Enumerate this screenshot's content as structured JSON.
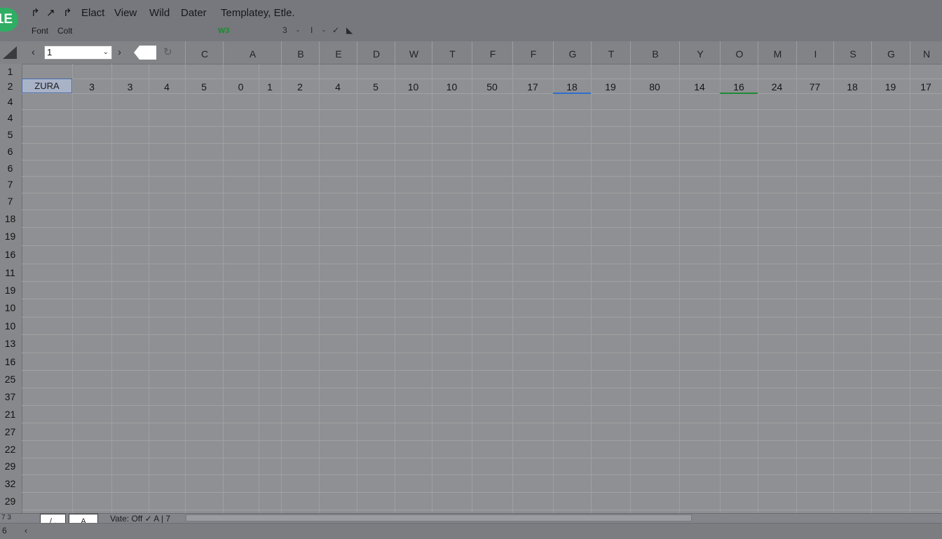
{
  "app": {
    "logo_text": "1E"
  },
  "quick_access": [
    "↱",
    "↗",
    "↱"
  ],
  "menu": [
    "Elact",
    "View",
    "Wild",
    "Dater",
    "Templatey, Etle."
  ],
  "submenu": {
    "font": "Font",
    "edit": "Colt",
    "green_label": "W3",
    "num": "3",
    "dash1": "-",
    "cursor": "I",
    "dash2": "-",
    "check": "✓",
    "fill": "◣"
  },
  "formula_bar": {
    "name_box_value": "1",
    "prev": "‹",
    "next": "›",
    "refresh": "↻"
  },
  "columns": [
    "C",
    "A",
    "B",
    "E",
    "D",
    "W",
    "T",
    "F",
    "F",
    "G",
    "T",
    "B",
    "Y",
    "O",
    "M",
    "I",
    "S",
    "G",
    "N"
  ],
  "rows": [
    "1",
    "2",
    "4",
    "4",
    "5",
    "6",
    "6",
    "7",
    "7",
    "18",
    "19",
    "16",
    "11",
    "19",
    "10",
    "10",
    "13",
    "16",
    "25",
    "37",
    "21",
    "27",
    "22",
    "29",
    "32",
    "29"
  ],
  "row2": {
    "first_cell": "ZURA",
    "values": [
      "3",
      "3",
      "4",
      "5",
      "0",
      "1",
      "2",
      "4",
      "5",
      "10",
      "10",
      "50",
      "17",
      "18",
      "19",
      "80",
      "14",
      "16",
      "24",
      "77",
      "18",
      "19",
      "17"
    ]
  },
  "sheets": {
    "tab1": "/ .",
    "tab2": "A",
    "status": "Vate: Off ✓  A | 7",
    "corner": "7 3"
  },
  "status_bar": {
    "left": "6",
    "caret": "‹"
  }
}
